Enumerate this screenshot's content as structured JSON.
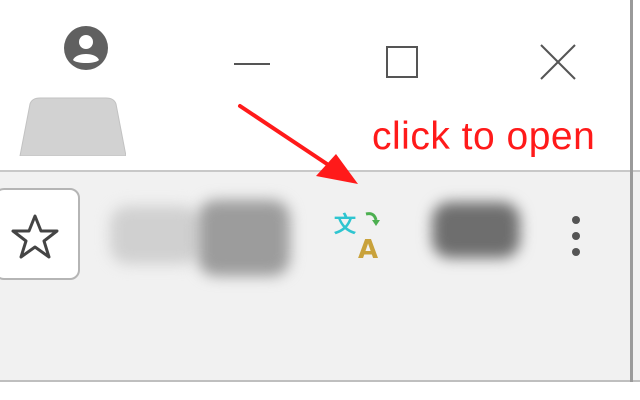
{
  "annotation": {
    "text": "click to open",
    "color": "#ff1a1a"
  },
  "window_controls": [
    "minimize-icon",
    "maximize-icon",
    "close-icon"
  ],
  "toolbar": {
    "bookmark_icon": "star-icon",
    "extensions": [
      "blurred-extension-icon",
      "blurred-extension-icon",
      "translate-icon",
      "blurred-extension-icon"
    ],
    "menu_icon": "more-vert-icon"
  },
  "translate_icon": {
    "glyph_top": "文",
    "glyph_bottom": "A",
    "colors": [
      "#2ec5d0",
      "#c9a23b",
      "#4caf50"
    ]
  }
}
